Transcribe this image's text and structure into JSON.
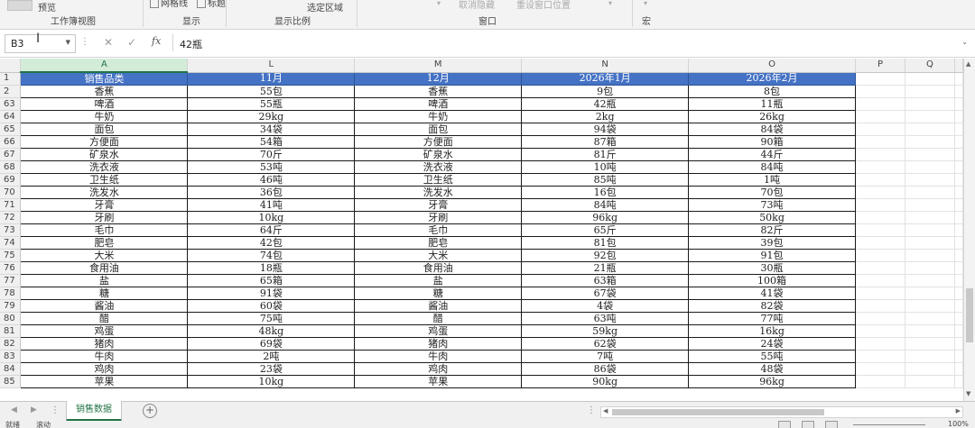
{
  "ribbon": {
    "preview": "预览",
    "workbook_views": "工作簿视图",
    "show_partial": "网格线",
    "show_partial2": "标题",
    "show": "显示",
    "zoom_to_selection": "选定区域",
    "zoom": "显示比例",
    "unhide": "取消隐藏",
    "reset_window": "重设窗口位置",
    "window": "窗口",
    "macro": "宏"
  },
  "formula_bar": {
    "name_box": "B3",
    "fx": "fx",
    "value": "42瓶"
  },
  "columns": [
    "A",
    "L",
    "M",
    "N",
    "O",
    "P",
    "Q"
  ],
  "header_row": {
    "row": "1",
    "cells": [
      "销售品类",
      "11月",
      "12月",
      "2026年1月",
      "2026年2月"
    ]
  },
  "rows": [
    {
      "n": "2",
      "cells": [
        "香蕉",
        "55包",
        "香蕉",
        "9包",
        "8包"
      ]
    },
    {
      "n": "63",
      "cells": [
        "啤酒",
        "55瓶",
        "啤酒",
        "42瓶",
        "11瓶"
      ]
    },
    {
      "n": "64",
      "cells": [
        "牛奶",
        "29kg",
        "牛奶",
        "2kg",
        "26kg"
      ]
    },
    {
      "n": "65",
      "cells": [
        "面包",
        "34袋",
        "面包",
        "94袋",
        "84袋"
      ]
    },
    {
      "n": "66",
      "cells": [
        "方便面",
        "54箱",
        "方便面",
        "87箱",
        "90箱"
      ]
    },
    {
      "n": "67",
      "cells": [
        "矿泉水",
        "70斤",
        "矿泉水",
        "81斤",
        "44斤"
      ]
    },
    {
      "n": "68",
      "cells": [
        "洗衣液",
        "53吨",
        "洗衣液",
        "10吨",
        "84吨"
      ]
    },
    {
      "n": "69",
      "cells": [
        "卫生纸",
        "46吨",
        "卫生纸",
        "85吨",
        "1吨"
      ]
    },
    {
      "n": "70",
      "cells": [
        "洗发水",
        "36包",
        "洗发水",
        "16包",
        "70包"
      ]
    },
    {
      "n": "71",
      "cells": [
        "牙膏",
        "41吨",
        "牙膏",
        "84吨",
        "73吨"
      ]
    },
    {
      "n": "72",
      "cells": [
        "牙刷",
        "10kg",
        "牙刷",
        "96kg",
        "50kg"
      ]
    },
    {
      "n": "73",
      "cells": [
        "毛巾",
        "64斤",
        "毛巾",
        "65斤",
        "82斤"
      ]
    },
    {
      "n": "74",
      "cells": [
        "肥皂",
        "42包",
        "肥皂",
        "81包",
        "39包"
      ]
    },
    {
      "n": "75",
      "cells": [
        "大米",
        "74包",
        "大米",
        "92包",
        "91包"
      ]
    },
    {
      "n": "76",
      "cells": [
        "食用油",
        "18瓶",
        "食用油",
        "21瓶",
        "30瓶"
      ]
    },
    {
      "n": "77",
      "cells": [
        "盐",
        "65箱",
        "盐",
        "63箱",
        "100箱"
      ]
    },
    {
      "n": "78",
      "cells": [
        "糖",
        "91袋",
        "糖",
        "67袋",
        "41袋"
      ]
    },
    {
      "n": "79",
      "cells": [
        "酱油",
        "60袋",
        "酱油",
        "4袋",
        "82袋"
      ]
    },
    {
      "n": "80",
      "cells": [
        "醋",
        "75吨",
        "醋",
        "63吨",
        "77吨"
      ]
    },
    {
      "n": "81",
      "cells": [
        "鸡蛋",
        "48kg",
        "鸡蛋",
        "59kg",
        "16kg"
      ]
    },
    {
      "n": "82",
      "cells": [
        "猪肉",
        "69袋",
        "猪肉",
        "62袋",
        "24袋"
      ]
    },
    {
      "n": "83",
      "cells": [
        "牛肉",
        "2吨",
        "牛肉",
        "7吨",
        "55吨"
      ]
    },
    {
      "n": "84",
      "cells": [
        "鸡肉",
        "23袋",
        "鸡肉",
        "86袋",
        "48袋"
      ]
    },
    {
      "n": "85",
      "cells": [
        "苹果",
        "10kg",
        "苹果",
        "90kg",
        "96kg"
      ]
    }
  ],
  "tabs": {
    "active_sheet": "销售数据",
    "add": "+"
  },
  "status": {
    "ready": "就绪",
    "scroll": "滚动",
    "zoom": "100%"
  },
  "colors": {
    "header_fill": "#4472c4",
    "accent": "#217346"
  }
}
